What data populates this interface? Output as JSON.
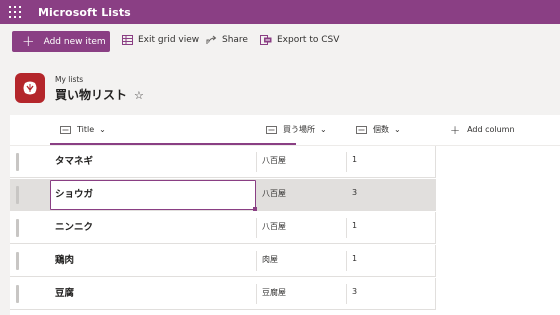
{
  "suite": {
    "app_name": "Microsoft Lists",
    "waffle_icon": "app-launcher-icon",
    "brand_color": "#8a3f84"
  },
  "commands": {
    "add_new_item": "Add new item",
    "exit_grid_view": "Exit grid view",
    "share": "Share",
    "export_csv": "Export to CSV"
  },
  "list": {
    "breadcrumb": "My lists",
    "title": "買い物リスト",
    "icon_color": "#b4262b"
  },
  "columns": {
    "title": "Title",
    "place": "買う場所",
    "count": "個数",
    "add_column": "Add column"
  },
  "rows": [
    {
      "title": "タマネギ",
      "place": "八百屋",
      "count": "1"
    },
    {
      "title": "ショウガ",
      "place": "八百屋",
      "count": "3",
      "selected": true
    },
    {
      "title": "ニンニク",
      "place": "八百屋",
      "count": "1"
    },
    {
      "title": "鶏肉",
      "place": "肉屋",
      "count": "1"
    },
    {
      "title": "豆腐",
      "place": "豆腐屋",
      "count": "3"
    }
  ]
}
